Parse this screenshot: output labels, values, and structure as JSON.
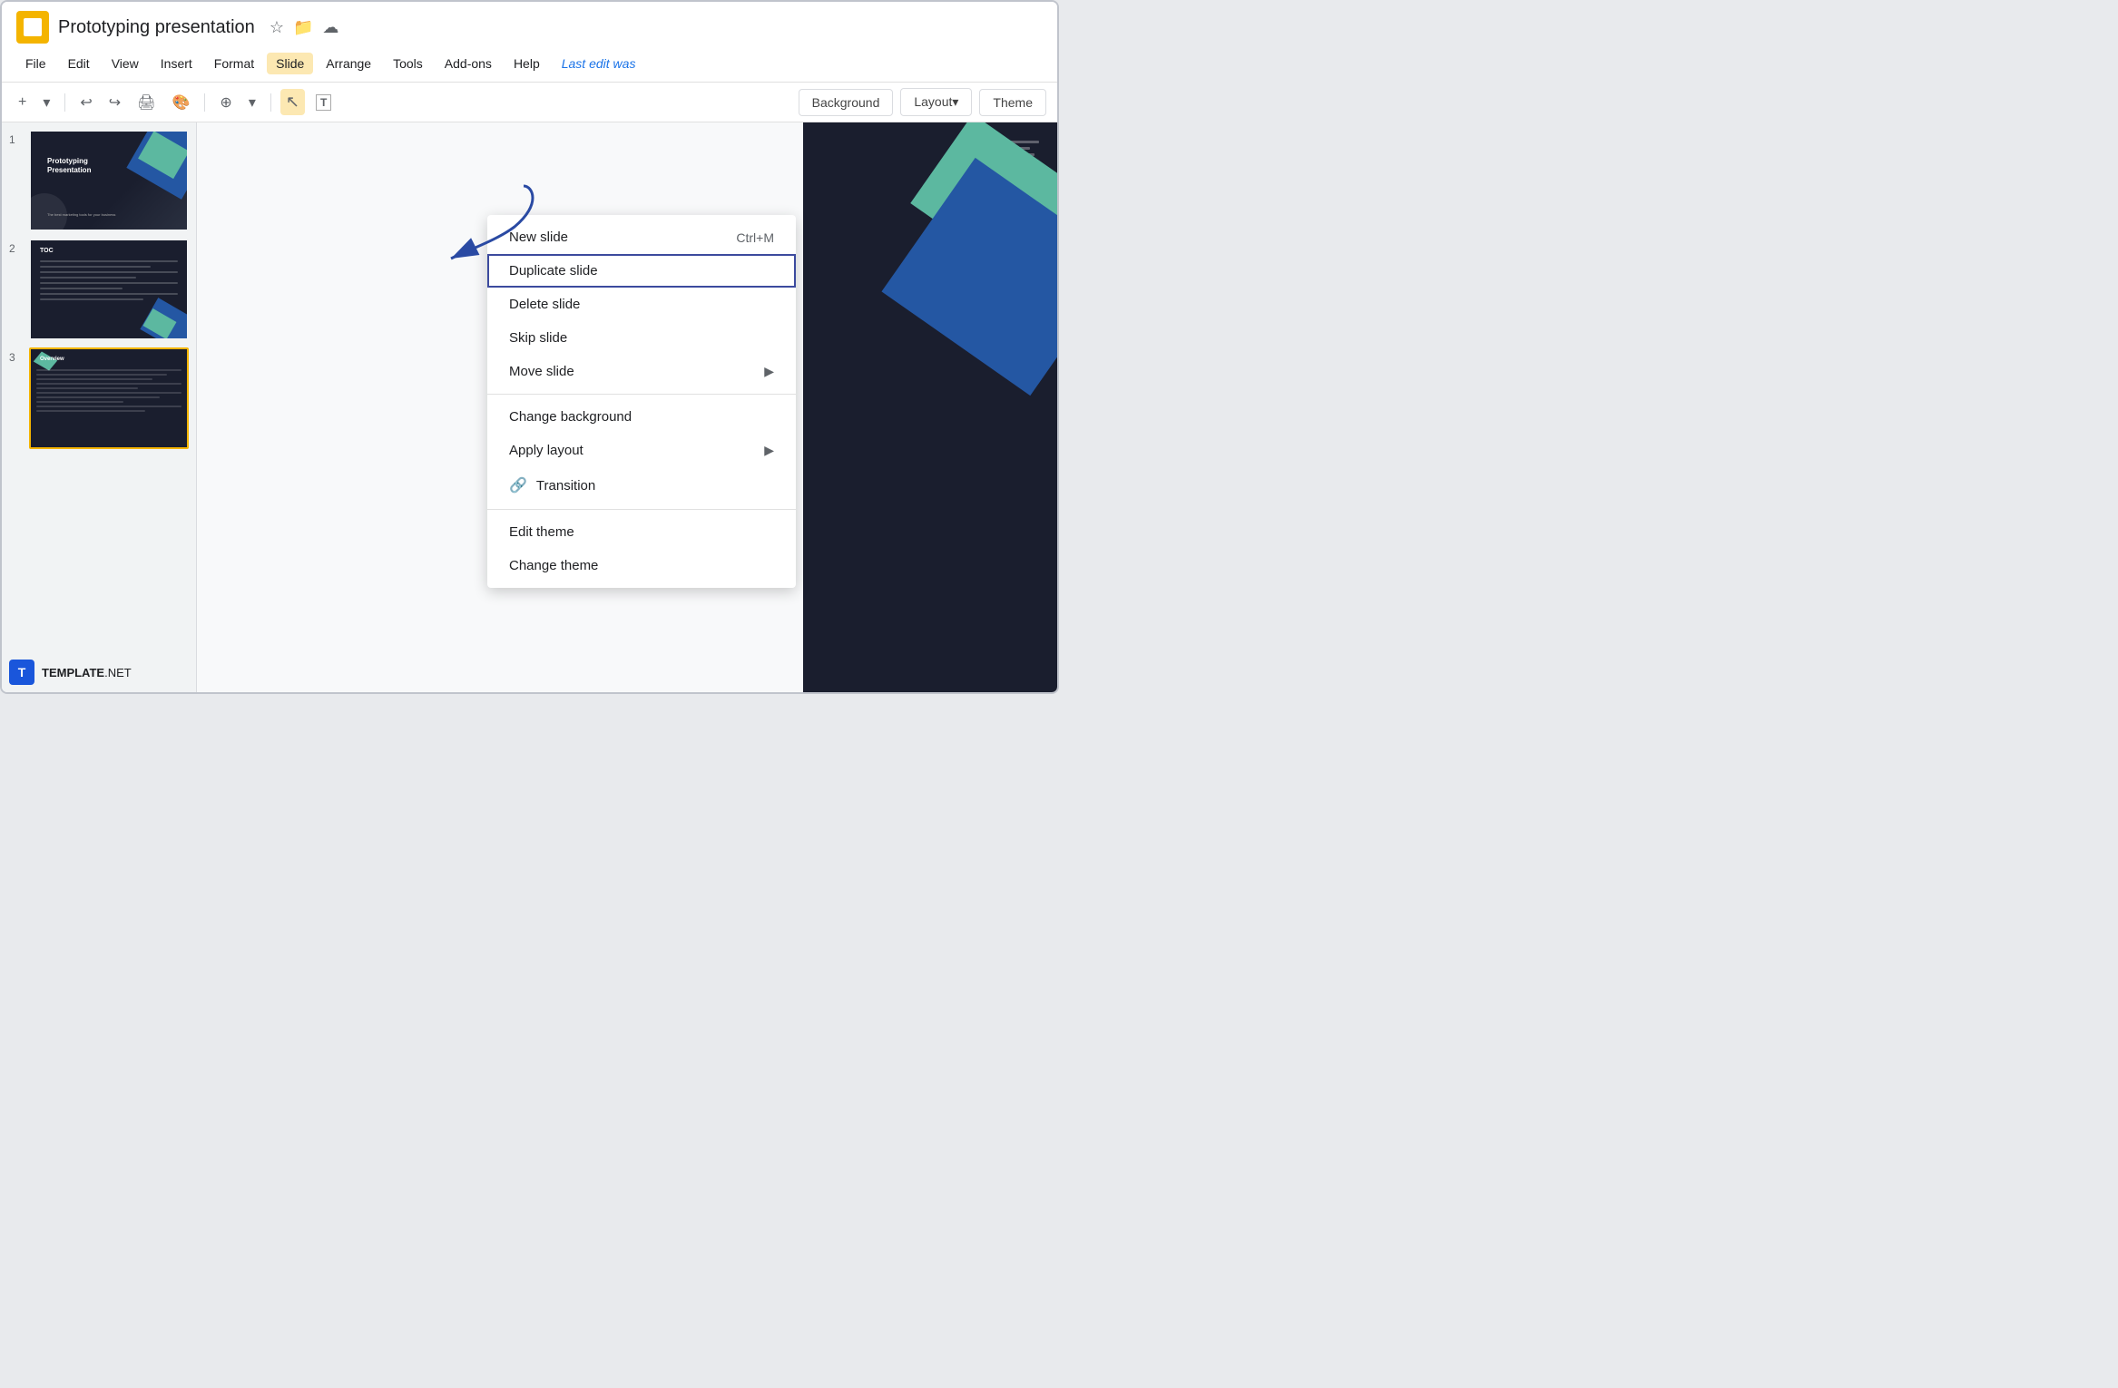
{
  "app": {
    "icon_label": "Slides",
    "title": "Prototyping presentation",
    "last_edit": "Last edit was"
  },
  "title_icons": {
    "star": "☆",
    "folder": "📁",
    "cloud": "☁"
  },
  "menu": {
    "items": [
      {
        "label": "File",
        "active": false
      },
      {
        "label": "Edit",
        "active": false
      },
      {
        "label": "View",
        "active": false
      },
      {
        "label": "Insert",
        "active": false
      },
      {
        "label": "Format",
        "active": false
      },
      {
        "label": "Slide",
        "active": true
      },
      {
        "label": "Arrange",
        "active": false
      },
      {
        "label": "Tools",
        "active": false
      },
      {
        "label": "Add-ons",
        "active": false
      },
      {
        "label": "Help",
        "active": false
      },
      {
        "label": "Last edit was",
        "active": false
      }
    ]
  },
  "toolbar": {
    "add_icon": "+",
    "add_dropdown": "▾",
    "undo": "↩",
    "redo": "↪",
    "print": "🖨",
    "paint_format": "🎨",
    "zoom_icon": "⊕",
    "zoom_dropdown": "▾",
    "cursor_active": true,
    "text_tool": "T",
    "right_buttons": {
      "background_label": "Background",
      "layout_label": "Layout▾",
      "theme_label": "Theme"
    }
  },
  "slides": [
    {
      "number": "1",
      "title": "Prototyping Presentation",
      "subtitle": "The best marketing tools for your business",
      "active": false
    },
    {
      "number": "2",
      "title": "TOC",
      "active": false
    },
    {
      "number": "3",
      "title": "Overview",
      "active": true
    }
  ],
  "dropdown_menu": {
    "items": [
      {
        "label": "New slide",
        "shortcut": "Ctrl+M",
        "has_arrow": false,
        "has_icon": false,
        "highlighted": false,
        "separator_after": false
      },
      {
        "label": "Duplicate slide",
        "shortcut": "",
        "has_arrow": false,
        "has_icon": false,
        "highlighted": true,
        "separator_after": false
      },
      {
        "label": "Delete slide",
        "shortcut": "",
        "has_arrow": false,
        "has_icon": false,
        "highlighted": false,
        "separator_after": false
      },
      {
        "label": "Skip slide",
        "shortcut": "",
        "has_arrow": false,
        "has_icon": false,
        "highlighted": false,
        "separator_after": false
      },
      {
        "label": "Move slide",
        "shortcut": "",
        "has_arrow": true,
        "has_icon": false,
        "highlighted": false,
        "separator_after": true
      },
      {
        "label": "Change background",
        "shortcut": "",
        "has_arrow": false,
        "has_icon": false,
        "highlighted": false,
        "separator_after": false
      },
      {
        "label": "Apply layout",
        "shortcut": "",
        "has_arrow": true,
        "has_icon": false,
        "highlighted": false,
        "separator_after": false
      },
      {
        "label": "Transition",
        "shortcut": "",
        "has_arrow": false,
        "has_icon": true,
        "icon": "🔗",
        "highlighted": false,
        "separator_after": true
      },
      {
        "label": "Edit theme",
        "shortcut": "",
        "has_arrow": false,
        "has_icon": false,
        "highlighted": false,
        "separator_after": false
      },
      {
        "label": "Change theme",
        "shortcut": "",
        "has_arrow": false,
        "has_icon": false,
        "highlighted": false,
        "separator_after": false
      }
    ]
  },
  "template_footer": {
    "icon_text": "T",
    "brand_prefix": "TEMPLATE",
    "brand_suffix": ".NET"
  },
  "colors": {
    "slide_bg": "#1a1e2e",
    "blue_shape": "#2457a3",
    "teal_shape": "#5cb8a0",
    "active_slide_border": "#F4B400",
    "menu_active_bg": "#fce8b2",
    "highlight_border": "#3c4a9e"
  }
}
